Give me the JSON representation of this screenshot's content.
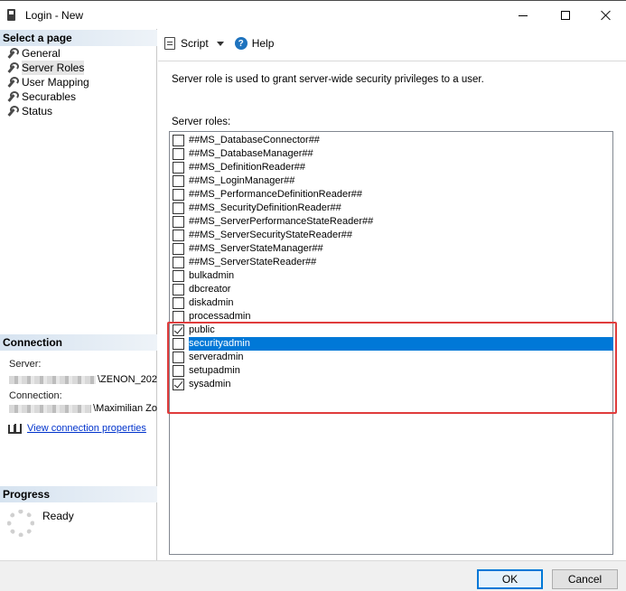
{
  "window": {
    "title": "Login - New"
  },
  "left_pane": {
    "select_page_header": "Select a page",
    "pages": [
      {
        "label": "General"
      },
      {
        "label": "Server Roles"
      },
      {
        "label": "User Mapping"
      },
      {
        "label": "Securables"
      },
      {
        "label": "Status"
      }
    ],
    "connection_header": "Connection",
    "server_label": "Server:",
    "server_value": "\\ZENON_202",
    "connection_label": "Connection:",
    "connection_value": "\\Maximilian Zo",
    "view_connection_link": "View connection properties",
    "progress_header": "Progress",
    "progress_status": "Ready"
  },
  "toolbar": {
    "script_label": "Script",
    "help_label": "Help"
  },
  "main": {
    "description": "Server role is used to grant server-wide security privileges to a user.",
    "roles_label": "Server roles:",
    "roles": [
      {
        "name": "##MS_DatabaseConnector##",
        "checked": false,
        "selected": false
      },
      {
        "name": "##MS_DatabaseManager##",
        "checked": false,
        "selected": false
      },
      {
        "name": "##MS_DefinitionReader##",
        "checked": false,
        "selected": false
      },
      {
        "name": "##MS_LoginManager##",
        "checked": false,
        "selected": false
      },
      {
        "name": "##MS_PerformanceDefinitionReader##",
        "checked": false,
        "selected": false
      },
      {
        "name": "##MS_SecurityDefinitionReader##",
        "checked": false,
        "selected": false
      },
      {
        "name": "##MS_ServerPerformanceStateReader##",
        "checked": false,
        "selected": false
      },
      {
        "name": "##MS_ServerSecurityStateReader##",
        "checked": false,
        "selected": false
      },
      {
        "name": "##MS_ServerStateManager##",
        "checked": false,
        "selected": false
      },
      {
        "name": "##MS_ServerStateReader##",
        "checked": false,
        "selected": false
      },
      {
        "name": "bulkadmin",
        "checked": false,
        "selected": false
      },
      {
        "name": "dbcreator",
        "checked": false,
        "selected": false
      },
      {
        "name": "diskadmin",
        "checked": false,
        "selected": false
      },
      {
        "name": "processadmin",
        "checked": false,
        "selected": false
      },
      {
        "name": "public",
        "checked": true,
        "selected": false
      },
      {
        "name": "securityadmin",
        "checked": false,
        "selected": true
      },
      {
        "name": "serveradmin",
        "checked": false,
        "selected": false
      },
      {
        "name": "setupadmin",
        "checked": false,
        "selected": false
      },
      {
        "name": "sysadmin",
        "checked": true,
        "selected": false
      }
    ]
  },
  "footer": {
    "ok_label": "OK",
    "cancel_label": "Cancel"
  },
  "colors": {
    "selection": "#0078d7",
    "highlight_box": "#e03c3c",
    "link": "#0033cc"
  }
}
